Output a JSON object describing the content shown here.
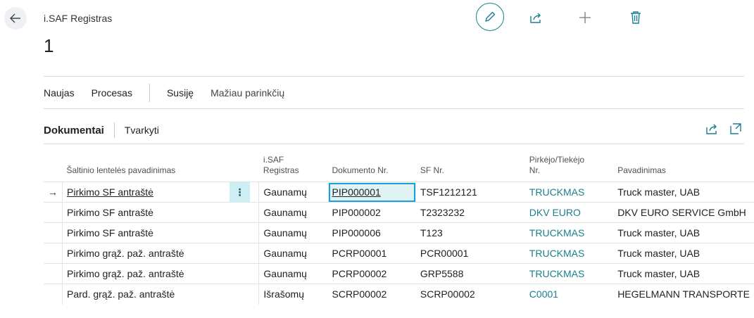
{
  "header": {
    "caption": "i.SAF Registras",
    "record_title": "1"
  },
  "toolbar_icons": [
    "back-arrow-icon",
    "pencil-icon",
    "share-icon",
    "plus-icon",
    "trash-icon"
  ],
  "actionbar": {
    "new": "Naujas",
    "process": "Procesas",
    "related": "Susiję",
    "fewer_options": "Mažiau parinkčių"
  },
  "part": {
    "title": "Dokumentai",
    "manage": "Tvarkyti"
  },
  "columns": {
    "table_name": "Šaltinio lentelės pavadinimas",
    "register_line1": "i.SAF",
    "register_line2": "Registras",
    "doc_no": "Dokumento Nr.",
    "inv_no": "SF Nr.",
    "party_line1": "Pirkėjo/Tiekėjo",
    "party_line2": "Nr.",
    "name": "Pavadinimas"
  },
  "rows": [
    {
      "table_name": "Pirkimo SF antraštė",
      "register": "Gaunamų",
      "doc_no": "PIP000001",
      "inv_no": "TSF1212121",
      "party_no": "TRUCKMAS",
      "name": "Truck master, UAB"
    },
    {
      "table_name": "Pirkimo SF antraštė",
      "register": "Gaunamų",
      "doc_no": "PIP000002",
      "inv_no": "T2323232",
      "party_no": "DKV EURO",
      "name": "DKV EURO SERVICE GmbH"
    },
    {
      "table_name": "Pirkimo SF antraštė",
      "register": "Gaunamų",
      "doc_no": "PIP000006",
      "inv_no": "T123",
      "party_no": "TRUCKMAS",
      "name": "Truck master, UAB"
    },
    {
      "table_name": "Pirkimo grąž. paž. antraštė",
      "register": "Gaunamų",
      "doc_no": "PCRP00001",
      "inv_no": "PCR00001",
      "party_no": "TRUCKMAS",
      "name": "Truck master, UAB"
    },
    {
      "table_name": "Pirkimo grąž. paž. antraštė",
      "register": "Gaunamų",
      "doc_no": "PCRP00002",
      "inv_no": "GRP5588",
      "party_no": "TRUCKMAS",
      "name": "Truck master, UAB"
    },
    {
      "table_name": "Pard. grąž. paž. antraštė",
      "register": "Išrašomų",
      "doc_no": "SCRP00002",
      "inv_no": "SCRP00002",
      "party_no": "C0001",
      "name": "HEGELMANN TRANSPORTE"
    }
  ],
  "colors": {
    "accent": "#1a7f8e",
    "focus": "#1d9fd9",
    "selected_cell": "#cdeef2"
  }
}
